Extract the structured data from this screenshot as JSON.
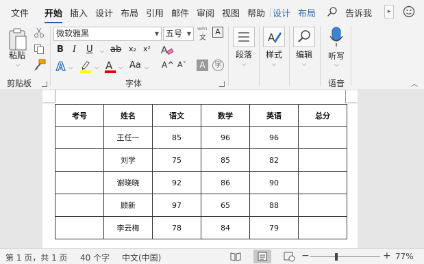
{
  "menu": {
    "tabs": [
      "文件",
      "开始",
      "插入",
      "设计",
      "布局",
      "引用",
      "邮件",
      "审阅",
      "视图",
      "帮助",
      "设计",
      "布局"
    ],
    "tell_me": "告诉我"
  },
  "ribbon": {
    "clipboard": {
      "paste_label": "粘贴",
      "group_label": "剪贴板"
    },
    "font": {
      "font_name": "微软雅黑",
      "font_size": "五号",
      "wen_label": "wén",
      "wen_char": "文",
      "bold": "B",
      "italic": "I",
      "underline": "U",
      "strike": "ab",
      "subscript": "x₂",
      "superscript": "x²",
      "case_label": "Aa",
      "grow_label": "A^",
      "shrink_label": "Aˇ",
      "group_label": "字体"
    },
    "paragraph": {
      "label": "段落"
    },
    "styles": {
      "label": "样式"
    },
    "editing": {
      "label": "编辑"
    },
    "voice": {
      "label": "听写",
      "group_label": "语音"
    }
  },
  "table": {
    "headers": [
      "考号",
      "姓名",
      "语文",
      "数学",
      "英语",
      "总分"
    ],
    "rows": [
      [
        "",
        "王任一",
        "85",
        "96",
        "96",
        ""
      ],
      [
        "",
        "刘学",
        "75",
        "85",
        "82",
        ""
      ],
      [
        "",
        "谢晓晓",
        "92",
        "86",
        "90",
        ""
      ],
      [
        "",
        "顾新",
        "97",
        "65",
        "88",
        ""
      ],
      [
        "",
        "李云梅",
        "78",
        "84",
        "79",
        ""
      ]
    ]
  },
  "status": {
    "page": "第 1 页，共 1 页",
    "words": "40 个字",
    "language": "中文(中国)",
    "minus": "−",
    "plus": "+",
    "zoom": "77%",
    "zoom_level": 0.77
  },
  "colors": {
    "accent": "#2b579a",
    "highlight": "#ffff00",
    "font_color": "#e00000",
    "text_effect": "#2b6cb0"
  }
}
